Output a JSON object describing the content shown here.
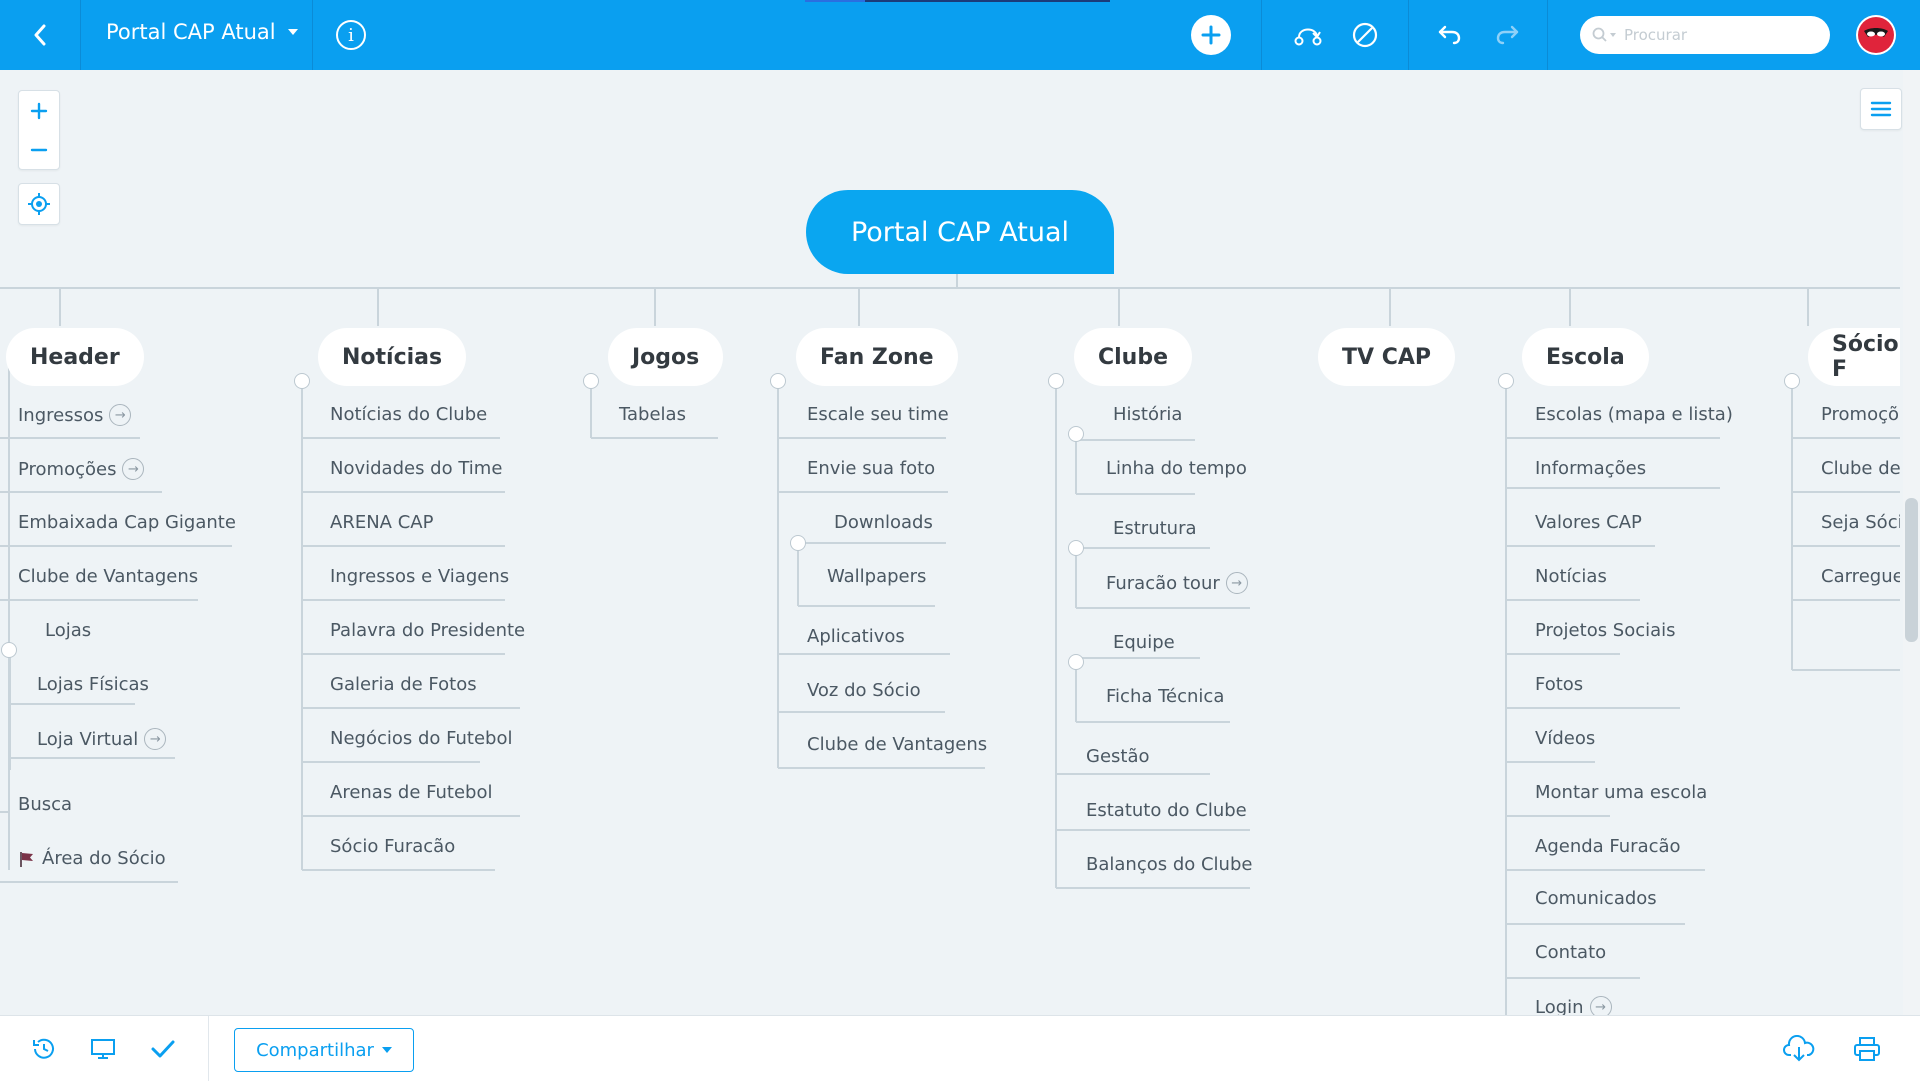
{
  "app": {
    "document_title": "Portal CAP Atual",
    "search_placeholder": "Procurar",
    "share_label": "Compartilhar",
    "accent_color": "#0a9ff0"
  },
  "toolbar_icons": [
    "back-icon",
    "info-icon",
    "add-icon",
    "connect-icon",
    "clear-style-icon",
    "undo-icon",
    "redo-icon",
    "search-icon",
    "avatar"
  ],
  "map": {
    "root": "Portal CAP Atual",
    "branches": [
      {
        "title": "Header",
        "items": [
          "Ingressos",
          "Promoções",
          "Embaixada Cap Gigante",
          "Clube de Vantagens",
          "Lojas",
          "Lojas Físicas",
          "Loja Virtual",
          "Busca",
          "Área do Sócio"
        ]
      },
      {
        "title": "Notícias",
        "items": [
          "Notícias do Clube",
          "Novidades do Time",
          "ARENA CAP",
          "Ingressos e Viagens",
          "Palavra do Presidente",
          "Galeria de Fotos",
          "Negócios do Futebol",
          "Arenas de Futebol",
          "Sócio Furacão"
        ]
      },
      {
        "title": "Jogos",
        "items": [
          "Tabelas"
        ]
      },
      {
        "title": "Fan Zone",
        "items": [
          "Escale seu time",
          "Envie sua foto",
          "Downloads",
          "Wallpapers",
          "Aplicativos",
          "Voz do Sócio",
          "Clube de Vantagens"
        ]
      },
      {
        "title": "Clube",
        "items": [
          "História",
          "Linha do tempo",
          "Estrutura",
          "Furacão tour",
          "Equipe",
          "Ficha Técnica",
          "Gestão",
          "Estatuto do Clube",
          "Balanços do Clube"
        ]
      },
      {
        "title": "TV CAP",
        "items": []
      },
      {
        "title": "Escola",
        "items": [
          "Escolas (mapa e lista)",
          "Informações",
          "Valores CAP",
          "Notícias",
          "Projetos Sociais",
          "Fotos",
          "Vídeos",
          "Montar uma escola",
          "Agenda Furacão",
          "Comunicados",
          "Contato",
          "Login"
        ]
      },
      {
        "title": "Sócio F",
        "items": [
          "Promoçõe",
          "Clube de",
          "Seja Sócio",
          "Carregue"
        ]
      }
    ]
  }
}
